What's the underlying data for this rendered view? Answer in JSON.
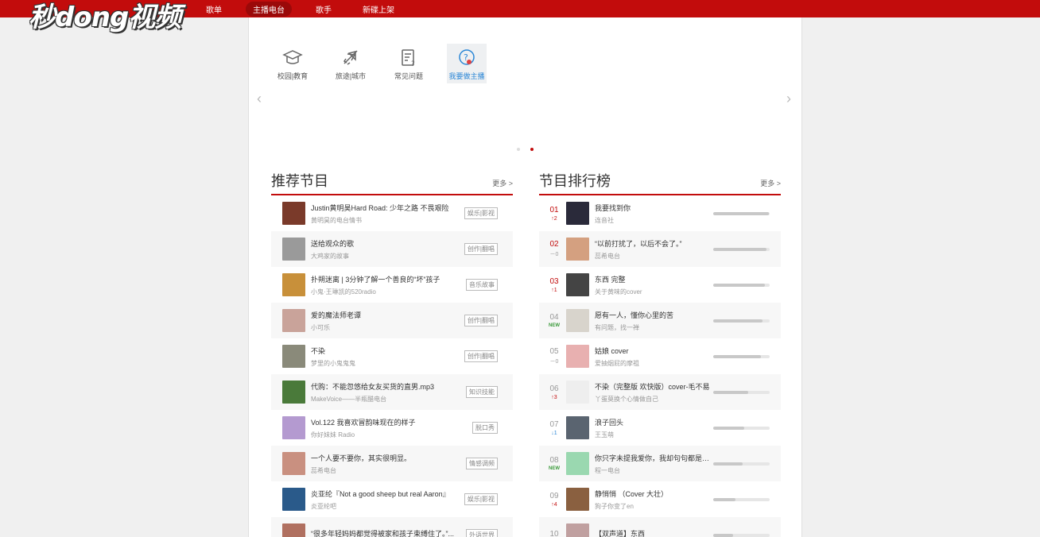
{
  "logo": "秒dong视频",
  "nav": [
    {
      "label": "歌单",
      "active": false
    },
    {
      "label": "主播电台",
      "active": true
    },
    {
      "label": "歌手",
      "active": false
    },
    {
      "label": "新碟上架",
      "active": false
    }
  ],
  "categories": [
    {
      "label": "校园|教育",
      "icon": "graduation-cap-icon"
    },
    {
      "label": "旅途|城市",
      "icon": "airplane-icon"
    },
    {
      "label": "常见问题",
      "icon": "faq-document-icon"
    },
    {
      "label": "我要做主播",
      "icon": "question-circle-icon"
    }
  ],
  "carousel": {
    "prev": "‹",
    "next": "›",
    "active_dot": 2
  },
  "recommend": {
    "title": "推荐节目",
    "more": "更多 >",
    "items": [
      {
        "title": "Justin黄明昊Hard Road: 少年之路 不畏艰险",
        "sub": "黄明昊的电台情书",
        "tag": "娱乐|影视",
        "color": "#7a3a2a"
      },
      {
        "title": "送给观众的歌",
        "sub": "大鸡家的故事",
        "tag": "创作|翻唱",
        "color": "#9a9a9a"
      },
      {
        "title": "扑朔迷离 | 3分钟了解一个善良的“坏”孩子",
        "sub": "小鬼·王琳凯的520radio",
        "tag": "音乐故事",
        "color": "#c8903a"
      },
      {
        "title": "爱的魔法师老谭",
        "sub": "小可乐",
        "tag": "创作|翻唱",
        "color": "#c9a39a"
      },
      {
        "title": "不染",
        "sub": "梦里的小鬼鬼鬼",
        "tag": "创作|翻唱",
        "color": "#8a8a7a"
      },
      {
        "title": "代购：不能忽悠给女友买货的直男.mp3",
        "sub": "MakeVoice——半瓶醋电台",
        "tag": "知识技能",
        "color": "#4a7a3a"
      },
      {
        "title": "Vol.122 我喜欢冒韵味现在的样子",
        "sub": "你好妹妹 Radio",
        "tag": "脱口秀",
        "color": "#b49ad0"
      },
      {
        "title": "一个人要不要你，其实很明显。",
        "sub": "蕊希电台",
        "tag": "情感调频",
        "color": "#c99080"
      },
      {
        "title": "炎亚纶『Not a good sheep but real Aaron』",
        "sub": "炎亚纶吧",
        "tag": "娱乐|影视",
        "color": "#2a5a8a"
      },
      {
        "title": "“很多年轻妈妈都觉得被家和孩子束缚住了。”...",
        "sub": "",
        "tag": "外语世界",
        "color": "#b07060"
      }
    ]
  },
  "ranking": {
    "title": "节目排行榜",
    "more": "更多 >",
    "items": [
      {
        "rank": "01",
        "change": "↑2",
        "dir": "up",
        "title": "我要找到你",
        "sub": "连音社",
        "progress": 0.98,
        "color": "#2a2a3a"
      },
      {
        "rank": "02",
        "change": "－0",
        "dir": "same",
        "title": "“以前打扰了，以后不会了。”",
        "sub": "蕊希电台",
        "progress": 0.95,
        "color": "#d4a080"
      },
      {
        "rank": "03",
        "change": "↑1",
        "dir": "up",
        "title": "东西 完整",
        "sub": "关于黄味的cover",
        "progress": 0.92,
        "color": "#444444"
      },
      {
        "rank": "04",
        "change": "NEW",
        "dir": "new",
        "title": "愿有一人，懂你心里的苦",
        "sub": "有问题，找一禅",
        "progress": 0.88,
        "color": "#d8d4cc"
      },
      {
        "rank": "05",
        "change": "－0",
        "dir": "same",
        "title": "姑娘 cover",
        "sub": "爱抽烟屁的摩祖",
        "progress": 0.85,
        "color": "#e8b0b0"
      },
      {
        "rank": "06",
        "change": "↑3",
        "dir": "up",
        "title": "不染（完整版 欢快版）cover-毛不易",
        "sub": "丫蛋莫换个心情做自己",
        "progress": 0.62,
        "color": "#eeeeee"
      },
      {
        "rank": "07",
        "change": "↓1",
        "dir": "down",
        "title": "浪子回头",
        "sub": "王玉萌",
        "progress": 0.55,
        "color": "#5a6470"
      },
      {
        "rank": "08",
        "change": "NEW",
        "dir": "new",
        "title": "你只字未提我爱你，我却句句都是我...",
        "sub": "程一电台",
        "progress": 0.52,
        "color": "#9ad8b0"
      },
      {
        "rank": "09",
        "change": "↑4",
        "dir": "up",
        "title": "静悄悄 （Cover 大壮）",
        "sub": "狗子你变了en",
        "progress": 0.4,
        "color": "#8a6040"
      },
      {
        "rank": "10",
        "change": "",
        "dir": "up",
        "title": "【双声道】东西",
        "sub": "",
        "progress": 0.35,
        "color": "#c0a0a0"
      }
    ]
  }
}
